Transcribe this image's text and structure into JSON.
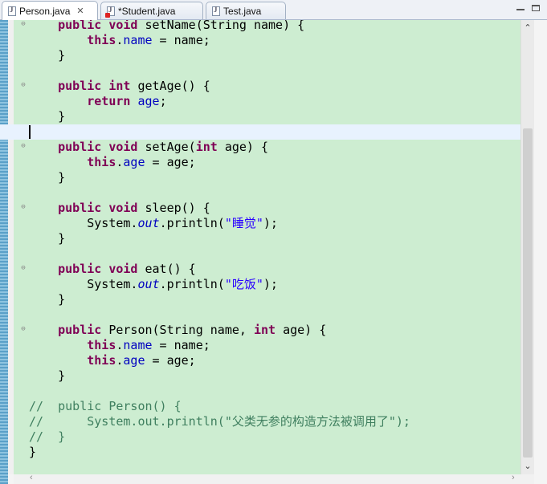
{
  "tabs": [
    {
      "label": "Person.java",
      "close": "✕",
      "active": true,
      "error": false
    },
    {
      "label": "*Student.java",
      "active": false,
      "error": true
    },
    {
      "label": "Test.java",
      "active": false,
      "error": false
    }
  ],
  "window_controls": {
    "minimize_icon": "minimize-icon",
    "maximize_icon": "maximize-icon"
  },
  "scrollbar": {
    "up": "⌃",
    "down": "⌄",
    "left": "‹",
    "right": "›"
  },
  "colors": {
    "background": "#cdedd1",
    "keyword": "#7f0055",
    "field": "#0000c0",
    "string": "#2a00ff",
    "comment": "#3f7f5f",
    "current_line": "#e8f2fe"
  },
  "code_lines": [
    {
      "fold": true,
      "tokens": [
        {
          "t": "    "
        },
        {
          "t": "public",
          "c": "kw"
        },
        {
          "t": " "
        },
        {
          "t": "void",
          "c": "kw"
        },
        {
          "t": " setName(String name) {"
        }
      ]
    },
    {
      "tokens": [
        {
          "t": "        "
        },
        {
          "t": "this",
          "c": "kw"
        },
        {
          "t": "."
        },
        {
          "t": "name",
          "c": "fld"
        },
        {
          "t": " = name;"
        }
      ]
    },
    {
      "tokens": [
        {
          "t": "    }"
        }
      ]
    },
    {
      "tokens": []
    },
    {
      "fold": true,
      "tokens": [
        {
          "t": "    "
        },
        {
          "t": "public",
          "c": "kw"
        },
        {
          "t": " "
        },
        {
          "t": "int",
          "c": "kw"
        },
        {
          "t": " getAge() {"
        }
      ]
    },
    {
      "tokens": [
        {
          "t": "        "
        },
        {
          "t": "return",
          "c": "kw"
        },
        {
          "t": " "
        },
        {
          "t": "age",
          "c": "fld"
        },
        {
          "t": ";"
        }
      ]
    },
    {
      "tokens": [
        {
          "t": "    }"
        }
      ]
    },
    {
      "current": true,
      "tokens": []
    },
    {
      "fold": true,
      "tokens": [
        {
          "t": "    "
        },
        {
          "t": "public",
          "c": "kw"
        },
        {
          "t": " "
        },
        {
          "t": "void",
          "c": "kw"
        },
        {
          "t": " setAge("
        },
        {
          "t": "int",
          "c": "kw"
        },
        {
          "t": " age) {"
        }
      ]
    },
    {
      "tokens": [
        {
          "t": "        "
        },
        {
          "t": "this",
          "c": "kw"
        },
        {
          "t": "."
        },
        {
          "t": "age",
          "c": "fld"
        },
        {
          "t": " = age;"
        }
      ]
    },
    {
      "tokens": [
        {
          "t": "    }"
        }
      ]
    },
    {
      "tokens": []
    },
    {
      "fold": true,
      "tokens": [
        {
          "t": "    "
        },
        {
          "t": "public",
          "c": "kw"
        },
        {
          "t": " "
        },
        {
          "t": "void",
          "c": "kw"
        },
        {
          "t": " sleep() {"
        }
      ]
    },
    {
      "tokens": [
        {
          "t": "        System."
        },
        {
          "t": "out",
          "c": "sfld"
        },
        {
          "t": ".println("
        },
        {
          "t": "\"睡觉\"",
          "c": "str"
        },
        {
          "t": ");"
        }
      ]
    },
    {
      "tokens": [
        {
          "t": "    }"
        }
      ]
    },
    {
      "tokens": []
    },
    {
      "fold": true,
      "tokens": [
        {
          "t": "    "
        },
        {
          "t": "public",
          "c": "kw"
        },
        {
          "t": " "
        },
        {
          "t": "void",
          "c": "kw"
        },
        {
          "t": " eat() {"
        }
      ]
    },
    {
      "tokens": [
        {
          "t": "        System."
        },
        {
          "t": "out",
          "c": "sfld"
        },
        {
          "t": ".println("
        },
        {
          "t": "\"吃饭\"",
          "c": "str"
        },
        {
          "t": ");"
        }
      ]
    },
    {
      "tokens": [
        {
          "t": "    }"
        }
      ]
    },
    {
      "tokens": []
    },
    {
      "fold": true,
      "tokens": [
        {
          "t": "    "
        },
        {
          "t": "public",
          "c": "kw"
        },
        {
          "t": " Person(String name, "
        },
        {
          "t": "int",
          "c": "kw"
        },
        {
          "t": " age) {"
        }
      ]
    },
    {
      "tokens": [
        {
          "t": "        "
        },
        {
          "t": "this",
          "c": "kw"
        },
        {
          "t": "."
        },
        {
          "t": "name",
          "c": "fld"
        },
        {
          "t": " = name;"
        }
      ]
    },
    {
      "tokens": [
        {
          "t": "        "
        },
        {
          "t": "this",
          "c": "kw"
        },
        {
          "t": "."
        },
        {
          "t": "age",
          "c": "fld"
        },
        {
          "t": " = age;"
        }
      ]
    },
    {
      "tokens": [
        {
          "t": "    }"
        }
      ]
    },
    {
      "tokens": []
    },
    {
      "tokens": [
        {
          "t": "//  public Person() {",
          "c": "cmt"
        }
      ]
    },
    {
      "tokens": [
        {
          "t": "//      System.out.println(\"父类无参的构造方法被调用了\");",
          "c": "cmt"
        }
      ]
    },
    {
      "tokens": [
        {
          "t": "//  }",
          "c": "cmt"
        }
      ]
    },
    {
      "tokens": [
        {
          "t": "}"
        }
      ]
    }
  ]
}
